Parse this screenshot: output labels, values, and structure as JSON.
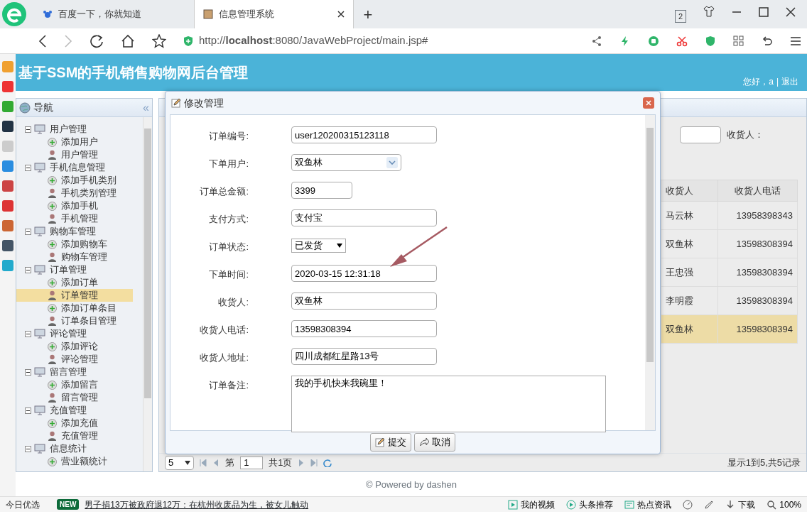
{
  "browser": {
    "tabs": [
      {
        "label": "百度一下，你就知道",
        "selected": false
      },
      {
        "label": "信息管理系统",
        "selected": true
      }
    ],
    "new_tab": "+",
    "tab_count": "2",
    "address": "http://**localhost**:8080/JavaWebProject/main.jsp#"
  },
  "header": {
    "title": "基于SSM的手机销售购物网后台管理",
    "greeting": "您好，a",
    "separator": "|",
    "logout": "退出"
  },
  "nav": {
    "title": "导航",
    "collapse": "«",
    "groups": [
      {
        "label": "用户管理",
        "expanded": true,
        "children": [
          {
            "label": "添加用户",
            "kind": "add",
            "selected": false
          },
          {
            "label": "用户管理",
            "kind": "manage",
            "selected": false
          }
        ]
      },
      {
        "label": "手机信息管理",
        "expanded": true,
        "children": [
          {
            "label": "添加手机类别",
            "kind": "add",
            "selected": false
          },
          {
            "label": "手机类别管理",
            "kind": "manage",
            "selected": false
          },
          {
            "label": "添加手机",
            "kind": "add",
            "selected": false
          },
          {
            "label": "手机管理",
            "kind": "manage",
            "selected": false
          }
        ]
      },
      {
        "label": "购物车管理",
        "expanded": true,
        "children": [
          {
            "label": "添加购物车",
            "kind": "add",
            "selected": false
          },
          {
            "label": "购物车管理",
            "kind": "manage",
            "selected": false
          }
        ]
      },
      {
        "label": "订单管理",
        "expanded": true,
        "children": [
          {
            "label": "添加订单",
            "kind": "add",
            "selected": false
          },
          {
            "label": "订单管理",
            "kind": "manage",
            "selected": true
          },
          {
            "label": "添加订单条目",
            "kind": "add",
            "selected": false
          },
          {
            "label": "订单条目管理",
            "kind": "manage",
            "selected": false
          }
        ]
      },
      {
        "label": "评论管理",
        "expanded": true,
        "children": [
          {
            "label": "添加评论",
            "kind": "add",
            "selected": false
          },
          {
            "label": "评论管理",
            "kind": "manage",
            "selected": false
          }
        ]
      },
      {
        "label": "留言管理",
        "expanded": true,
        "children": [
          {
            "label": "添加留言",
            "kind": "add",
            "selected": false
          },
          {
            "label": "留言管理",
            "kind": "manage",
            "selected": false
          }
        ]
      },
      {
        "label": "充值管理",
        "expanded": true,
        "children": [
          {
            "label": "添加充值",
            "kind": "add",
            "selected": false
          },
          {
            "label": "充值管理",
            "kind": "manage",
            "selected": false
          }
        ]
      },
      {
        "label": "信息统计",
        "expanded": true,
        "children": [
          {
            "label": "营业额统计",
            "kind": "add",
            "selected": false
          }
        ]
      }
    ]
  },
  "main": {
    "search_label": "收货人：",
    "columns": [
      "收货人",
      "收货人电话"
    ],
    "rows": [
      {
        "cells": [
          "马云林",
          "13958398343"
        ],
        "selected": false
      },
      {
        "cells": [
          "双鱼林",
          "13598308394"
        ],
        "selected": false
      },
      {
        "cells": [
          "王忠强",
          "13598308394"
        ],
        "selected": false
      },
      {
        "cells": [
          "李明霞",
          "13598308394"
        ],
        "selected": false
      },
      {
        "cells": [
          "双鱼林",
          "13598308394"
        ],
        "selected": true
      }
    ],
    "pager": {
      "page_size": "5",
      "page_label": "第",
      "page": "1",
      "total_pages": "共1页",
      "summary": "显示1到5,共5记录"
    }
  },
  "dialog": {
    "title": "修改管理",
    "fields": [
      {
        "label": "订单编号:",
        "kind": "text",
        "value": "user120200315123118"
      },
      {
        "label": "下单用户:",
        "kind": "combo",
        "value": "双鱼林"
      },
      {
        "label": "订单总金额:",
        "kind": "number",
        "value": "3399"
      },
      {
        "label": "支付方式:",
        "kind": "text",
        "value": "支付宝"
      },
      {
        "label": "订单状态:",
        "kind": "dropdown",
        "value": "已发货"
      },
      {
        "label": "下单时间:",
        "kind": "text",
        "value": "2020-03-15 12:31:18"
      },
      {
        "label": "收货人:",
        "kind": "text",
        "value": "双鱼林"
      },
      {
        "label": "收货人电话:",
        "kind": "text",
        "value": "13598308394"
      },
      {
        "label": "收货人地址:",
        "kind": "text",
        "value": "四川成都红星路13号"
      },
      {
        "label": "订单备注:",
        "kind": "textarea",
        "value": "我的手机快来我碗里！"
      }
    ],
    "buttons": [
      {
        "label": "提交",
        "kind": "submit"
      },
      {
        "label": "取消",
        "kind": "cancel"
      }
    ]
  },
  "footer": "© Powered by dashen",
  "status_bar": {
    "label": "今日优选",
    "badge": "NEW",
    "headline": "男子捐13万被政府退12万：在杭州收废品为生，被女儿触动",
    "items": [
      {
        "kind": "video",
        "label": "我的视频"
      },
      {
        "kind": "play",
        "label": "头条推荐"
      },
      {
        "kind": "news",
        "label": "热点资讯"
      },
      {
        "kind": "download",
        "label": "下载"
      },
      {
        "kind": "zoom",
        "label": "100%"
      }
    ]
  }
}
